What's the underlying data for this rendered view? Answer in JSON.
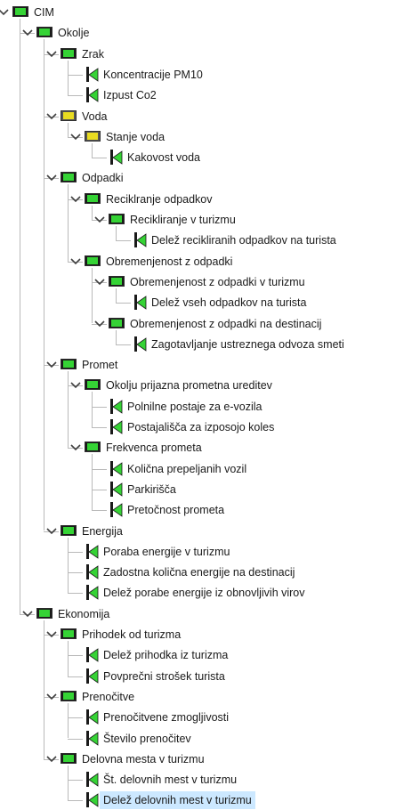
{
  "tree": {
    "label": "CIM",
    "status": "green",
    "children": [
      {
        "label": "Okolje",
        "status": "green",
        "children": [
          {
            "label": "Zrak",
            "status": "green",
            "children": [
              {
                "label": "Koncentracije PM10",
                "status": "green"
              },
              {
                "label": "Izpust Co2",
                "status": "green"
              }
            ]
          },
          {
            "label": "Voda",
            "status": "yellow",
            "children": [
              {
                "label": "Stanje voda",
                "status": "yellow",
                "children": [
                  {
                    "label": "Kakovost voda",
                    "status": "green"
                  }
                ]
              }
            ]
          },
          {
            "label": "Odpadki",
            "status": "green",
            "children": [
              {
                "label": "Reciklranje odpadkov",
                "status": "green",
                "children": [
                  {
                    "label": "Recikliranje v turizmu",
                    "status": "green",
                    "children": [
                      {
                        "label": "Delež recikliranih odpadkov na turista",
                        "status": "green"
                      }
                    ]
                  }
                ]
              },
              {
                "label": "Obremenjenost z odpadki",
                "status": "green",
                "children": [
                  {
                    "label": "Obremenjenost z odpadki v turizmu",
                    "status": "green",
                    "children": [
                      {
                        "label": "Delež vseh odpadkov na turista",
                        "status": "green"
                      }
                    ]
                  },
                  {
                    "label": "Obremenjenost z odpadki na destinacij",
                    "status": "green",
                    "children": [
                      {
                        "label": "Zagotavljanje ustreznega odvoza smeti",
                        "status": "green"
                      }
                    ]
                  }
                ]
              }
            ]
          },
          {
            "label": "Promet",
            "status": "green",
            "children": [
              {
                "label": "Okolju prijazna prometna ureditev",
                "status": "green",
                "children": [
                  {
                    "label": "Polnilne postaje za e-vozila",
                    "status": "green"
                  },
                  {
                    "label": "Postajališča za izposojo koles",
                    "status": "green"
                  }
                ]
              },
              {
                "label": "Frekvenca prometa",
                "status": "green",
                "children": [
                  {
                    "label": "Količna prepeljanih vozil",
                    "status": "green"
                  },
                  {
                    "label": "Parkirišča",
                    "status": "green"
                  },
                  {
                    "label": "Pretočnost prometa",
                    "status": "green"
                  }
                ]
              }
            ]
          },
          {
            "label": "Energija",
            "status": "green",
            "children": [
              {
                "label": "Poraba energije v turizmu",
                "status": "green"
              },
              {
                "label": "Zadostna količna energije na destinacij",
                "status": "green"
              },
              {
                "label": "Delež porabe energije iz obnovljivih virov",
                "status": "green"
              }
            ]
          }
        ]
      },
      {
        "label": "Ekonomija",
        "status": "green",
        "children": [
          {
            "label": "Prihodek od turizma",
            "status": "green",
            "children": [
              {
                "label": "Delež prihodka iz turizma",
                "status": "green"
              },
              {
                "label": "Povprečni strošek turista",
                "status": "green"
              }
            ]
          },
          {
            "label": "Prenočitve",
            "status": "green",
            "children": [
              {
                "label": "Prenočitvene zmogljivosti",
                "status": "green"
              },
              {
                "label": "Število prenočitev",
                "status": "green"
              }
            ]
          },
          {
            "label": "Delovna mesta v turizmu",
            "status": "green",
            "children": [
              {
                "label": "Št. delovnih mest v turizmu",
                "status": "green"
              },
              {
                "label": "Delež delovnih mest v turizmu",
                "status": "green",
                "selected": true
              }
            ]
          }
        ]
      }
    ]
  },
  "colors": {
    "green": "#35d335",
    "yellow": "#e9dc21",
    "selection": "#cce8ff",
    "connector": "#b9b9b9"
  }
}
